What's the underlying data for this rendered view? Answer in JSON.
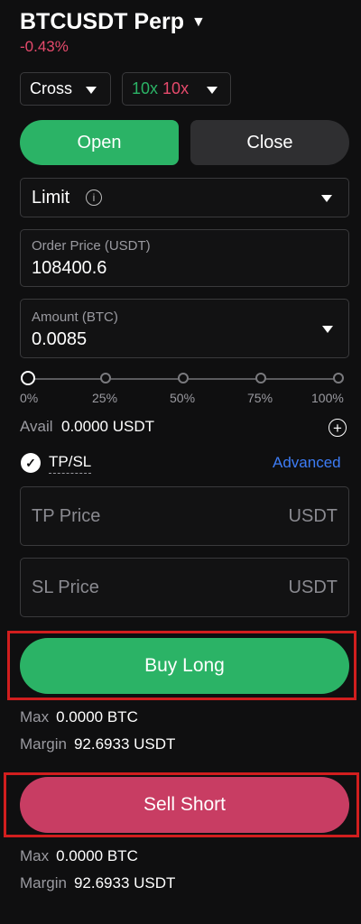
{
  "header": {
    "pair": "BTCUSDT",
    "type": "Perp",
    "change": "-0.43%"
  },
  "margin_mode": {
    "value": "Cross"
  },
  "leverage": {
    "long": "10x",
    "short": "10x",
    "long_color": "#2bb366",
    "short_color": "#e64a6c"
  },
  "tabs": {
    "open": "Open",
    "close": "Close"
  },
  "order_type": {
    "value": "Limit"
  },
  "order_price": {
    "label": "Order Price (USDT)",
    "value": "108400.6"
  },
  "amount": {
    "label": "Amount (BTC)",
    "value": "0.0085"
  },
  "slider": {
    "position_percent": 0,
    "marks": [
      "0%",
      "25%",
      "50%",
      "75%",
      "100%"
    ]
  },
  "available": {
    "label": "Avail",
    "value": "0.0000 USDT"
  },
  "tpsl": {
    "label": "TP/SL",
    "checked": true,
    "advanced": "Advanced"
  },
  "tp": {
    "placeholder": "TP Price",
    "unit": "USDT"
  },
  "sl": {
    "placeholder": "SL Price",
    "unit": "USDT"
  },
  "buy": {
    "label": "Buy Long",
    "max_label": "Max",
    "max_value": "0.0000 BTC",
    "margin_label": "Margin",
    "margin_value": "92.6933 USDT"
  },
  "sell": {
    "label": "Sell Short",
    "max_label": "Max",
    "max_value": "0.0000 BTC",
    "margin_label": "Margin",
    "margin_value": "92.6933 USDT"
  },
  "colors": {
    "green": "#2bb366",
    "red": "#c83d63",
    "link": "#3d7cf5"
  }
}
